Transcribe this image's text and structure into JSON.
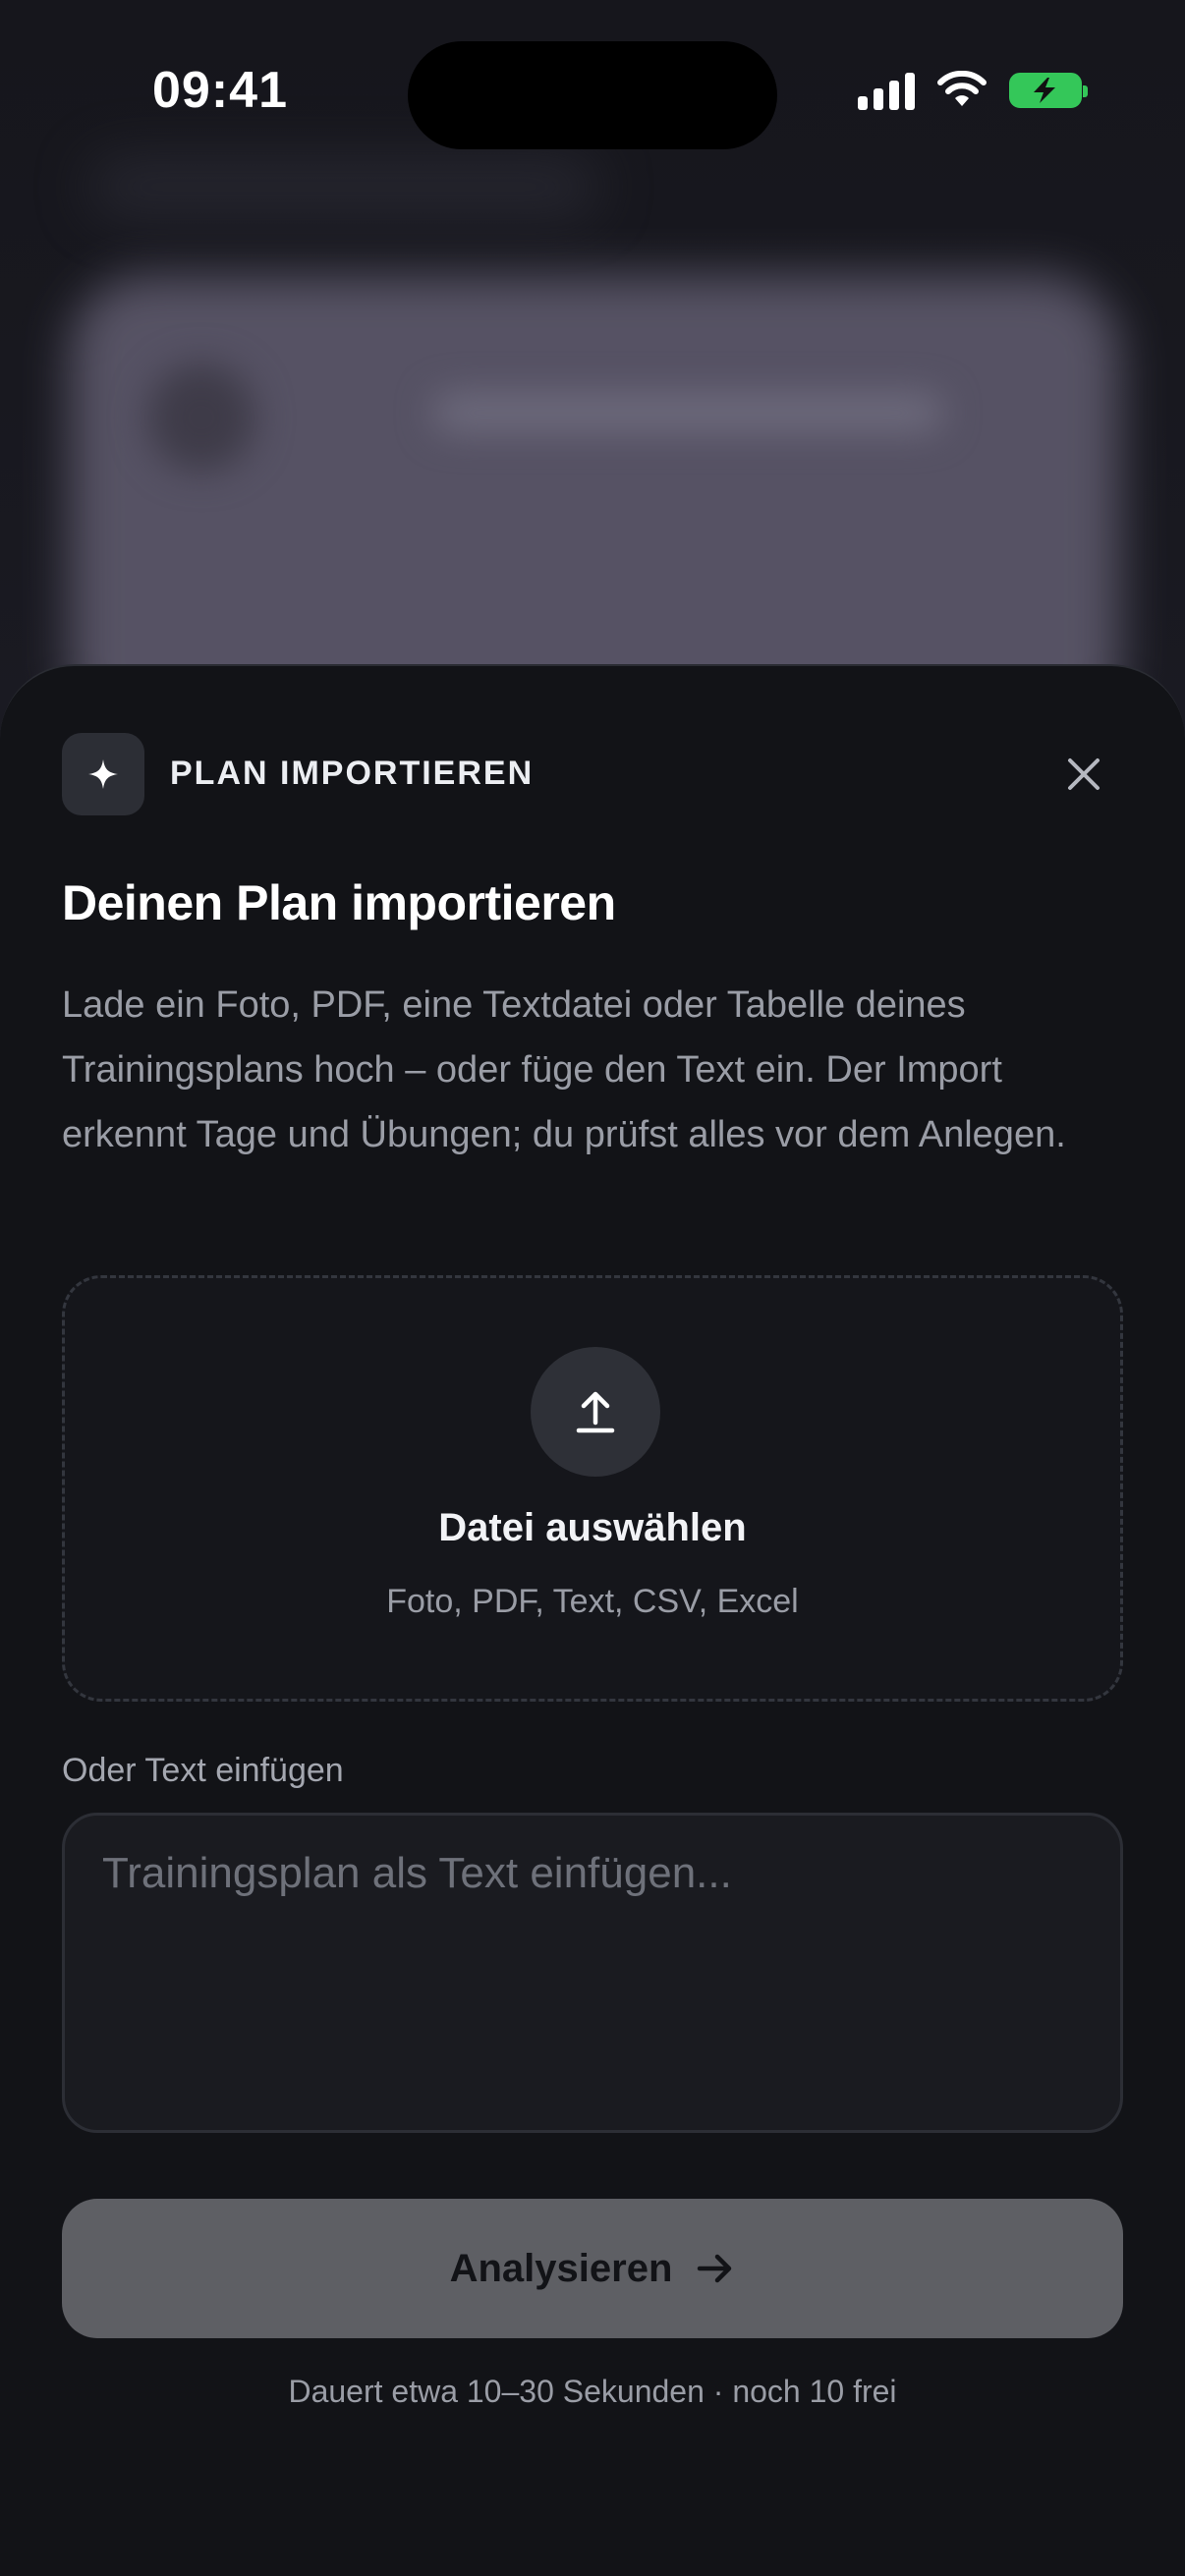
{
  "status_bar": {
    "time": "09:41",
    "battery_color": "#34c759"
  },
  "sheet": {
    "header_label": "PLAN IMPORTIEREN",
    "header_icon": "sparkle-icon",
    "close_icon": "close-icon",
    "title": "Deinen Plan importieren",
    "description": "Lade ein Foto, PDF, eine Textdatei oder Tabelle deines Trainingsplans hoch – oder füge den Text ein. Der Import erkennt Tage und Übungen; du prüfst alles vor dem Anlegen."
  },
  "upload": {
    "icon": "upload-icon",
    "label": "Datei auswählen",
    "hint": "Foto, PDF, Text, CSV, Excel"
  },
  "paste": {
    "label": "Oder Text einfügen",
    "placeholder": "Trainingsplan als Text einfügen...",
    "value": ""
  },
  "analyze": {
    "label": "Analysieren",
    "icon": "arrow-right-icon"
  },
  "footer": {
    "note": "Dauert etwa 10–30 Sekunden · noch 10 frei"
  }
}
